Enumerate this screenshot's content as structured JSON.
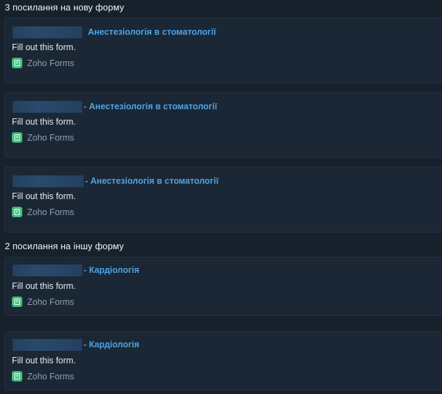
{
  "sections": [
    {
      "heading": "3 посилання на нову форму",
      "cards": [
        {
          "title": "Анестезіологія в стоматології",
          "desc": "Fill out this form.",
          "source": "Zoho Forms"
        },
        {
          "title": "- Анестезіологія в стоматології",
          "desc": "Fill out this form.",
          "source": "Zoho Forms"
        },
        {
          "title": "- Анестезіологія в стоматології",
          "desc": "Fill out this form.",
          "source": "Zoho Forms"
        }
      ]
    },
    {
      "heading": "2 посилання на іншу форму",
      "cards": [
        {
          "title": "- Кардіологія",
          "desc": "Fill out this form.",
          "source": "Zoho Forms"
        },
        {
          "title": "- Кардіологія",
          "desc": "Fill out this form.",
          "source": "Zoho Forms"
        }
      ]
    }
  ],
  "colors": {
    "background": "#17212b",
    "card": "#1b2734",
    "link": "#4ea3e6",
    "zoho_icon": "#3fbd7a"
  },
  "icons": {
    "source_icon": "zoho-forms-icon"
  }
}
